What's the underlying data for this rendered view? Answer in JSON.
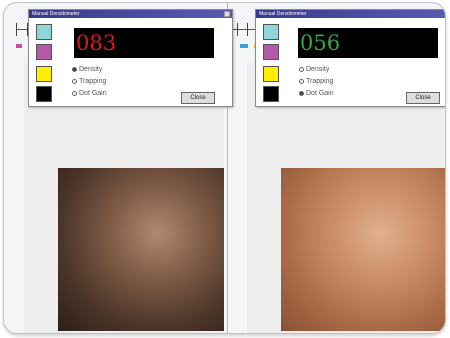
{
  "ruler": {
    "bar_colors": [
      "#d04aa0",
      "#3aa0d8",
      "#e8d020",
      "#222222",
      "#888888"
    ]
  },
  "left_dialog": {
    "title": "Manual Densitometer",
    "readout": "083",
    "readout_color": "#e01818",
    "swatches": [
      "#8fd6d8",
      "#b25aa8",
      "#ffee00",
      "#000000"
    ],
    "options": [
      {
        "label": "Density",
        "checked": true
      },
      {
        "label": "Trapping",
        "checked": false
      },
      {
        "label": "Dot Gain",
        "checked": false
      }
    ],
    "button_label": "Close",
    "close_icon": "close-box-icon"
  },
  "right_dialog": {
    "title": "Manual Densitometer",
    "readout": "056",
    "readout_color": "#2fa84a",
    "swatches": [
      "#8fd6d8",
      "#b25aa8",
      "#ffee00",
      "#000000"
    ],
    "options": [
      {
        "label": "Density",
        "checked": false
      },
      {
        "label": "Trapping",
        "checked": false
      },
      {
        "label": "Dot Gain",
        "checked": true
      }
    ],
    "button_label": "Close"
  },
  "colors": {
    "frame_border": "#bfc3c7",
    "titlebar": "#3a3a8c"
  }
}
